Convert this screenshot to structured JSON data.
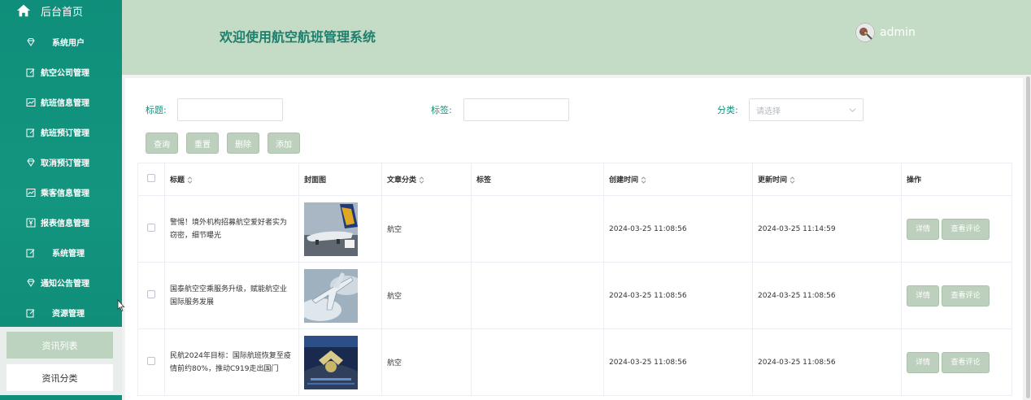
{
  "sidebar": {
    "home_label": "后台首页",
    "items": [
      {
        "label": "系统用户",
        "icon": "diamond-icon"
      },
      {
        "label": "航空公司管理",
        "icon": "edit-icon"
      },
      {
        "label": "航班信息管理",
        "icon": "chart-icon"
      },
      {
        "label": "航班预订管理",
        "icon": "edit-icon"
      },
      {
        "label": "取消预订管理",
        "icon": "diamond-icon"
      },
      {
        "label": "乘客信息管理",
        "icon": "chart-icon"
      },
      {
        "label": "报表信息管理",
        "icon": "yen-icon"
      },
      {
        "label": "系统管理",
        "icon": "edit-icon"
      },
      {
        "label": "通知公告管理",
        "icon": "diamond-icon"
      },
      {
        "label": "资源管理",
        "icon": "edit-icon"
      }
    ],
    "submenu": {
      "active": "资讯列表",
      "normal": "资讯分类"
    }
  },
  "header": {
    "title": "欢迎使用航空航班管理系统",
    "username": "admin"
  },
  "filters": {
    "title_label": "标题:",
    "tag_label": "标签:",
    "category_label": "分类:",
    "category_placeholder": "请选择"
  },
  "buttons": {
    "search": "查询",
    "reset": "重置",
    "delete": "删除",
    "add": "添加"
  },
  "table": {
    "headers": {
      "title": "标题",
      "cover": "封面图",
      "category": "文章分类",
      "tag": "标签",
      "created": "创建时间",
      "updated": "更新时间",
      "actions": "操作"
    },
    "rows": [
      {
        "title": "警惕！境外机构招募航空爱好者实为窃密，细节曝光",
        "category": "航空",
        "tag": "",
        "created": "2024-03-25 11:08:56",
        "updated": "2024-03-25 11:14:59"
      },
      {
        "title": "国泰航空空乘服务升级，赋能航空业国际服务发展",
        "category": "航空",
        "tag": "",
        "created": "2024-03-25 11:08:56",
        "updated": "2024-03-25 11:08:56"
      },
      {
        "title": "民航2024年目标：国际航班恢复至疫情前约80%，推动C919走出国门",
        "category": "航空",
        "tag": "",
        "created": "2024-03-25 11:08:56",
        "updated": "2024-03-25 11:08:56"
      }
    ],
    "row_actions": {
      "detail": "详情",
      "comments": "查看评论"
    }
  },
  "colors": {
    "sidebar": "#0f8f7b",
    "header": "#c4dbc6",
    "accent": "#17907c",
    "button": "#bcd0bd"
  }
}
